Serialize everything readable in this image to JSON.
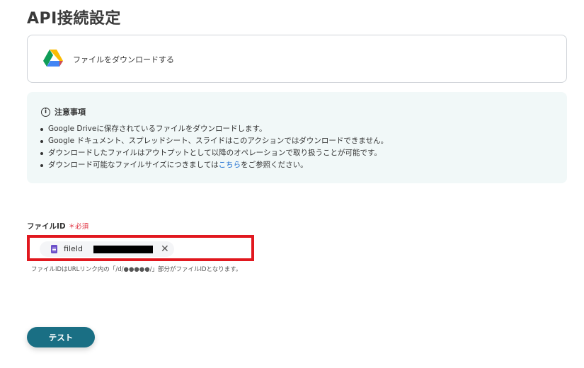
{
  "page": {
    "title": "API接続設定"
  },
  "action": {
    "label": "ファイルをダウンロードする",
    "icon": "google-drive-icon"
  },
  "notice": {
    "title": "注意事項",
    "icon": "info-icon",
    "items": [
      "Google Driveに保存されているファイルをダウンロードします。",
      "Google ドキュメント、スプレッドシート、スライドはこのアクションではダウンロードできません。",
      "ダウンロードしたファイルはアウトプットとして以降のオペレーションで取り扱うことが可能です。"
    ],
    "last_item": {
      "prefix": "ダウンロード可能なファイルサイズにつきましては",
      "link": "こちら",
      "suffix": "をご参照ください。"
    }
  },
  "field": {
    "label": "ファイルID",
    "required": "＊必須",
    "chip_text": "fileId",
    "helper": "ファイルIDはURLリンク内の「/d/●●●●●/」部分がファイルIDとなります。"
  },
  "buttons": {
    "test": "テスト"
  },
  "colors": {
    "button": "#1a6f84",
    "highlight": "#e1181f",
    "notice_bg": "#f1f8f8",
    "required": "#e02d3c",
    "link": "#1f6fd1"
  }
}
